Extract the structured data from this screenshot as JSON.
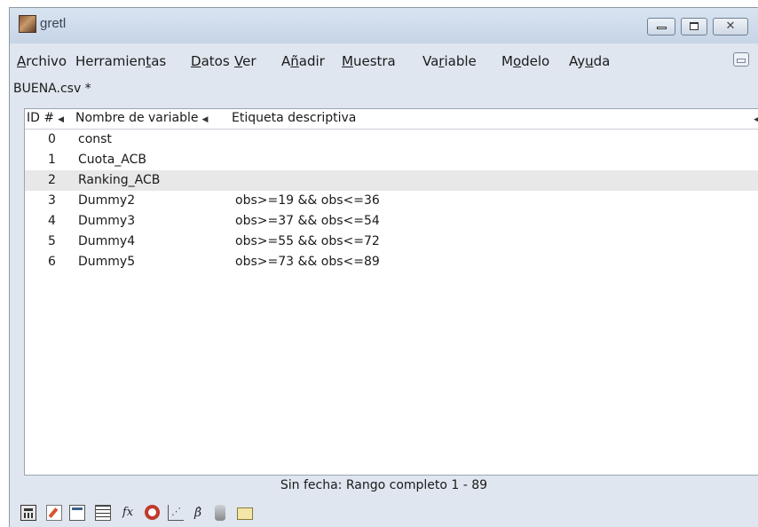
{
  "window": {
    "title": "gretl",
    "close_glyph": "✕"
  },
  "menu": [
    {
      "pre": "",
      "u": "A",
      "post": "rchivo"
    },
    {
      "pre": "Herramien",
      "u": "t",
      "post": "as"
    },
    {
      "pre": "",
      "u": "D",
      "post": "atos"
    },
    {
      "pre": "",
      "u": "V",
      "post": "er"
    },
    {
      "pre": "A",
      "u": "ñ",
      "post": "adir"
    },
    {
      "pre": "",
      "u": "M",
      "post": "uestra"
    },
    {
      "pre": "Va",
      "u": "r",
      "post": "iable"
    },
    {
      "pre": "M",
      "u": "o",
      "post": "delo"
    },
    {
      "pre": "Ay",
      "u": "u",
      "post": "da"
    }
  ],
  "dataset": {
    "filename": "BUENA.csv *"
  },
  "table": {
    "headers": {
      "id": "ID #",
      "name": "Nombre de variable",
      "label": "Etiqueta descriptiva",
      "sort_glyph": "◀"
    },
    "selected_row": 2,
    "rows": [
      {
        "id": "0",
        "name": "const",
        "label": ""
      },
      {
        "id": "1",
        "name": "Cuota_ACB",
        "label": ""
      },
      {
        "id": "2",
        "name": "Ranking_ACB",
        "label": ""
      },
      {
        "id": "3",
        "name": "Dummy2",
        "label": "obs>=19 && obs<=36"
      },
      {
        "id": "4",
        "name": "Dummy3",
        "label": "obs>=37 && obs<=54"
      },
      {
        "id": "5",
        "name": "Dummy4",
        "label": "obs>=55 && obs<=72"
      },
      {
        "id": "6",
        "name": "Dummy5",
        "label": "obs>=73 && obs<=89"
      }
    ]
  },
  "status": {
    "text": "Sin fecha: Rango completo 1 - 89"
  },
  "toolbar": {
    "fx_label": "fx",
    "beta_label": "β̂",
    "icons": [
      "calculator-icon",
      "script-editor-icon",
      "terminal-icon",
      "data-grid-icon",
      "function-icon",
      "help-lifebuoy-icon",
      "scatter-plot-icon",
      "model-beta-icon",
      "database-icon",
      "folder-icon"
    ]
  }
}
